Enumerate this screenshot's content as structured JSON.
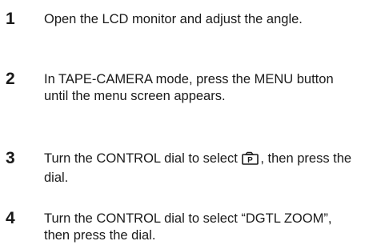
{
  "steps": [
    {
      "number": "1",
      "text": "Open the LCD monitor and adjust the angle."
    },
    {
      "number": "2",
      "text": "In TAPE-CAMERA mode, press the MENU button until the menu screen appears."
    },
    {
      "number": "3",
      "text_before": "Turn the CONTROL dial to select",
      "icon": "camera-p-menu-icon",
      "text_after": ", then press the dial."
    },
    {
      "number": "4",
      "text": "Turn the CONTROL dial to select “DGTL ZOOM”, then press the dial."
    }
  ]
}
